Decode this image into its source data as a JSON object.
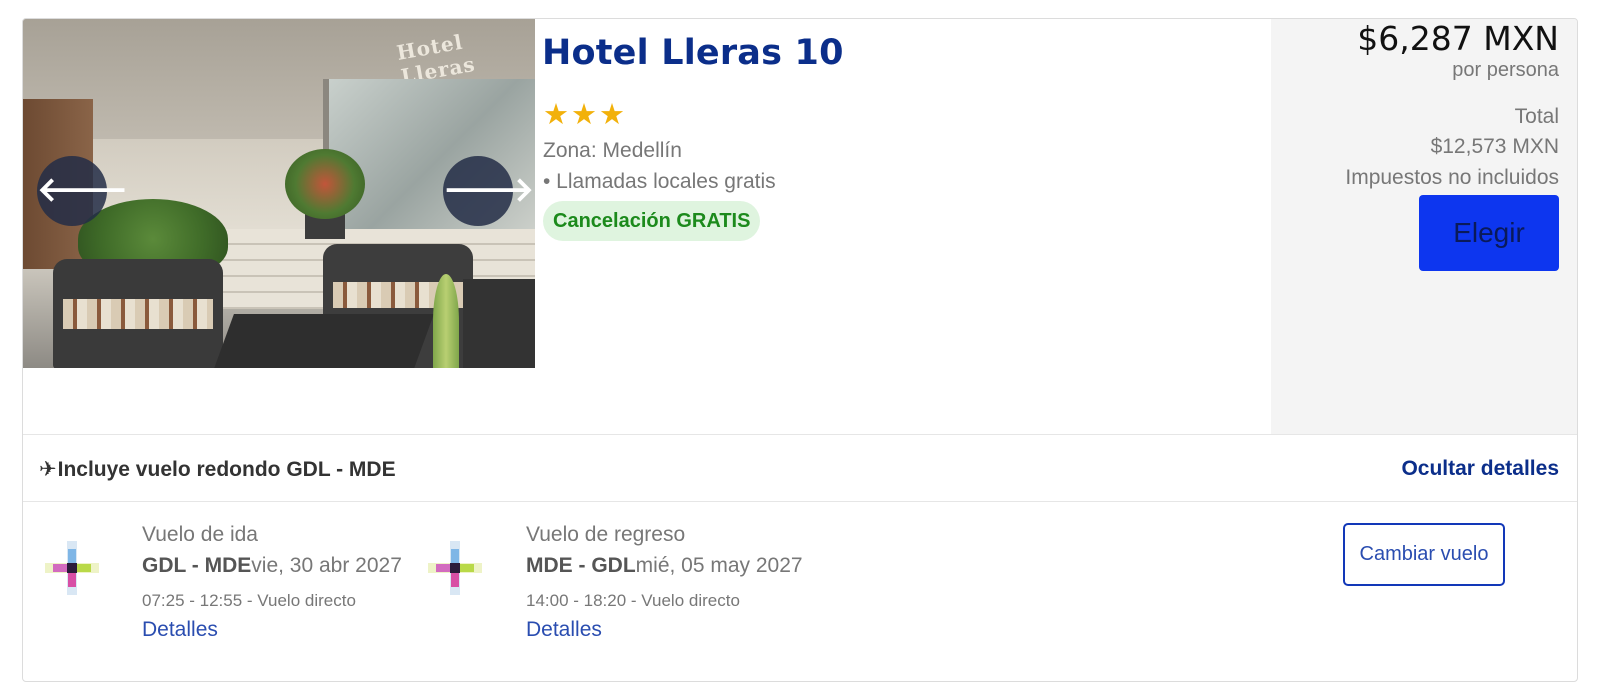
{
  "hotel": {
    "name": "Hotel Lleras 10",
    "stars": "★★★",
    "star_count": 3,
    "zone": "Zona: Medellín",
    "amenity": "• Llamadas locales gratis",
    "cancellation": "Cancelación GRATIS",
    "photo_sign": "Hotel Lleras"
  },
  "carousel": {
    "prev": "🡐",
    "next": "🡒"
  },
  "pricing": {
    "price": "$6,287 MXN",
    "per_person": "por persona",
    "total_label": "Total",
    "total_value": "$12,573 MXN",
    "taxes": "Impuestos no incluidos",
    "choose": "Elegir"
  },
  "flight_bar": {
    "icon": "✈",
    "text": "Incluye vuelo redondo GDL - MDE",
    "hide_details": "Ocultar detalles"
  },
  "flights": {
    "outbound": {
      "title": "Vuelo de ida",
      "route": "GDL - MDE",
      "date": "vie, 30 abr 2027",
      "times": "07:25 - 12:55 - Vuelo directo",
      "details": "Detalles"
    },
    "return": {
      "title": "Vuelo de regreso",
      "route": "MDE - GDL",
      "date": "mié, 05 may 2027",
      "times": "14:00 - 18:20 - Vuelo directo",
      "details": "Detalles"
    },
    "change": "Cambiar vuelo"
  },
  "colors": {
    "brand_blue": "#0b2e8a",
    "cta_blue": "#0d36ef",
    "star": "#f2b10b",
    "badge_bg": "#dff4df",
    "badge_text": "#1c8a1c"
  }
}
